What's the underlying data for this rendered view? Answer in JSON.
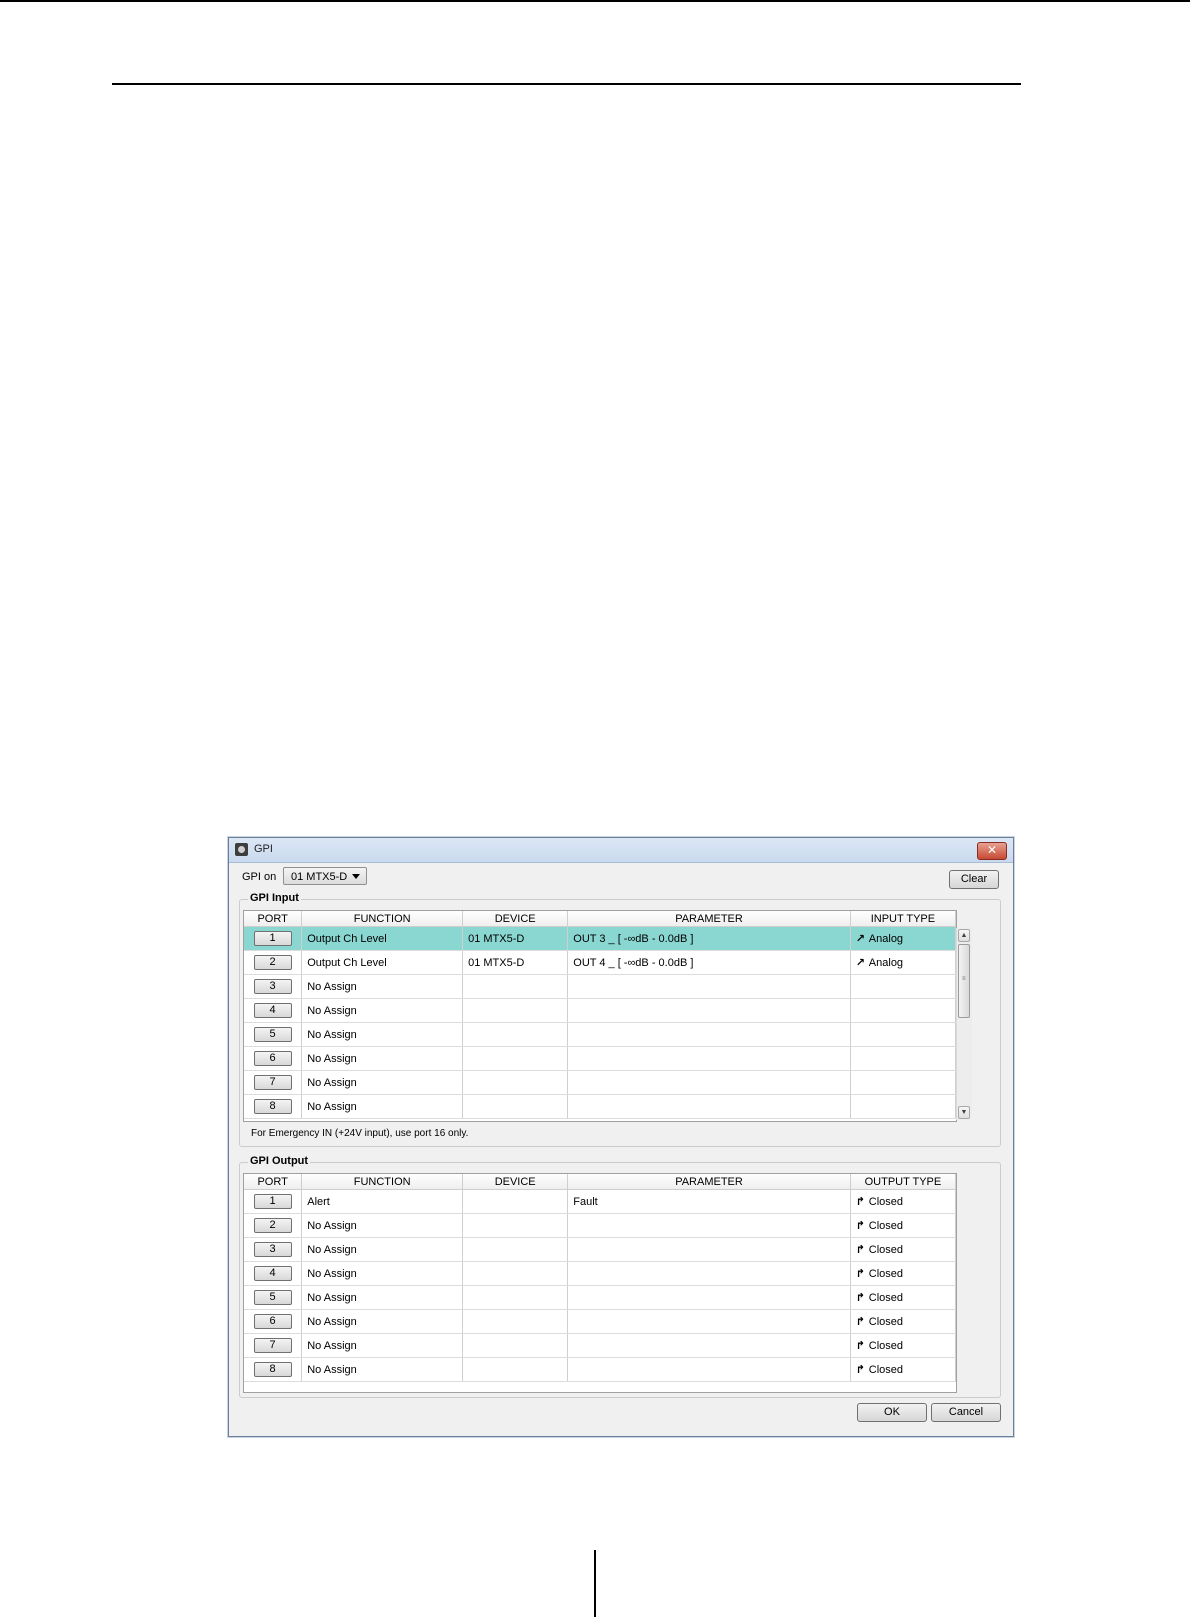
{
  "dialog": {
    "title": "GPI",
    "close_glyph": "✕",
    "gpi_on_label": "GPI on",
    "gpi_on_value": "01 MTX5-D",
    "clear_label": "Clear",
    "ok_label": "OK",
    "cancel_label": "Cancel"
  },
  "gpi_input": {
    "legend": "GPI Input",
    "headers": [
      "PORT",
      "FUNCTION",
      "DEVICE",
      "PARAMETER",
      "INPUT TYPE"
    ],
    "selected_row": 0,
    "rows": [
      {
        "port": "1",
        "function": "Output Ch Level",
        "device": "01 MTX5-D",
        "parameter": "OUT 3 _ [ -∞dB - 0.0dB ]",
        "type_icon": "↗",
        "type": "Analog"
      },
      {
        "port": "2",
        "function": "Output Ch Level",
        "device": "01 MTX5-D",
        "parameter": "OUT 4 _ [ -∞dB - 0.0dB ]",
        "type_icon": "↗",
        "type": "Analog"
      },
      {
        "port": "3",
        "function": "No Assign",
        "device": "",
        "parameter": "",
        "type_icon": "",
        "type": ""
      },
      {
        "port": "4",
        "function": "No Assign",
        "device": "",
        "parameter": "",
        "type_icon": "",
        "type": ""
      },
      {
        "port": "5",
        "function": "No Assign",
        "device": "",
        "parameter": "",
        "type_icon": "",
        "type": ""
      },
      {
        "port": "6",
        "function": "No Assign",
        "device": "",
        "parameter": "",
        "type_icon": "",
        "type": ""
      },
      {
        "port": "7",
        "function": "No Assign",
        "device": "",
        "parameter": "",
        "type_icon": "",
        "type": ""
      },
      {
        "port": "8",
        "function": "No Assign",
        "device": "",
        "parameter": "",
        "type_icon": "",
        "type": ""
      }
    ],
    "note": "For Emergency IN (+24V input), use port 16 only."
  },
  "gpi_output": {
    "legend": "GPI Output",
    "headers": [
      "PORT",
      "FUNCTION",
      "DEVICE",
      "PARAMETER",
      "OUTPUT TYPE"
    ],
    "rows": [
      {
        "port": "1",
        "function": "Alert",
        "device": "",
        "parameter": "Fault",
        "type_icon": "↱",
        "type": "Closed"
      },
      {
        "port": "2",
        "function": "No Assign",
        "device": "",
        "parameter": "",
        "type_icon": "↱",
        "type": "Closed"
      },
      {
        "port": "3",
        "function": "No Assign",
        "device": "",
        "parameter": "",
        "type_icon": "↱",
        "type": "Closed"
      },
      {
        "port": "4",
        "function": "No Assign",
        "device": "",
        "parameter": "",
        "type_icon": "↱",
        "type": "Closed"
      },
      {
        "port": "5",
        "function": "No Assign",
        "device": "",
        "parameter": "",
        "type_icon": "↱",
        "type": "Closed"
      },
      {
        "port": "6",
        "function": "No Assign",
        "device": "",
        "parameter": "",
        "type_icon": "↱",
        "type": "Closed"
      },
      {
        "port": "7",
        "function": "No Assign",
        "device": "",
        "parameter": "",
        "type_icon": "↱",
        "type": "Closed"
      },
      {
        "port": "8",
        "function": "No Assign",
        "device": "",
        "parameter": "",
        "type_icon": "↱",
        "type": "Closed"
      }
    ]
  },
  "colors": {
    "selected_row": "#8ad7d2",
    "title_bar": "#c9d9ee",
    "close_button": "#c64a34"
  }
}
